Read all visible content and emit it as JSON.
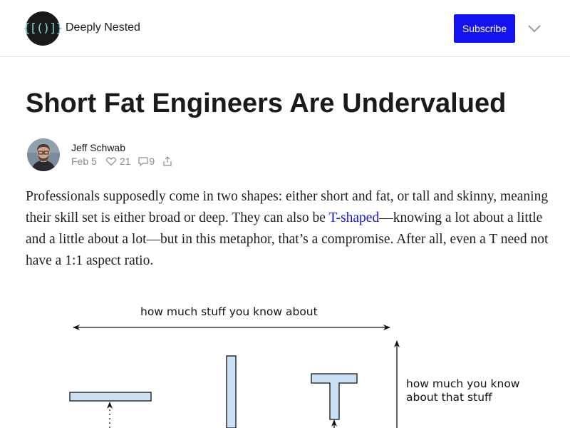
{
  "header": {
    "logo_text": "{[()]}",
    "publication_name": "Deeply Nested",
    "subscribe_label": "Subscribe",
    "accent_color": "#1313f2"
  },
  "post": {
    "title": "Short Fat Engineers Are Undervalued",
    "author": "Jeff Schwab",
    "date": "Feb 5",
    "likes": "21",
    "comments": "9",
    "body": {
      "part1": "Professionals supposedly come in two shapes: either short and fat, or tall and skinny, meaning their skill set is either broad or deep. They can also be ",
      "link_text": "T-shaped",
      "part2": "—knowing a lot about a little and a little about a lot—but in this metaphor, that’s a compromise. After all, even a T need not have a 1:1 aspect ratio."
    }
  },
  "figure": {
    "breadth_label": "how much stuff you know about",
    "depth_label_line1": "how much you know",
    "depth_label_line2": "about that stuff",
    "shape_fill": "#c9e0f5"
  }
}
